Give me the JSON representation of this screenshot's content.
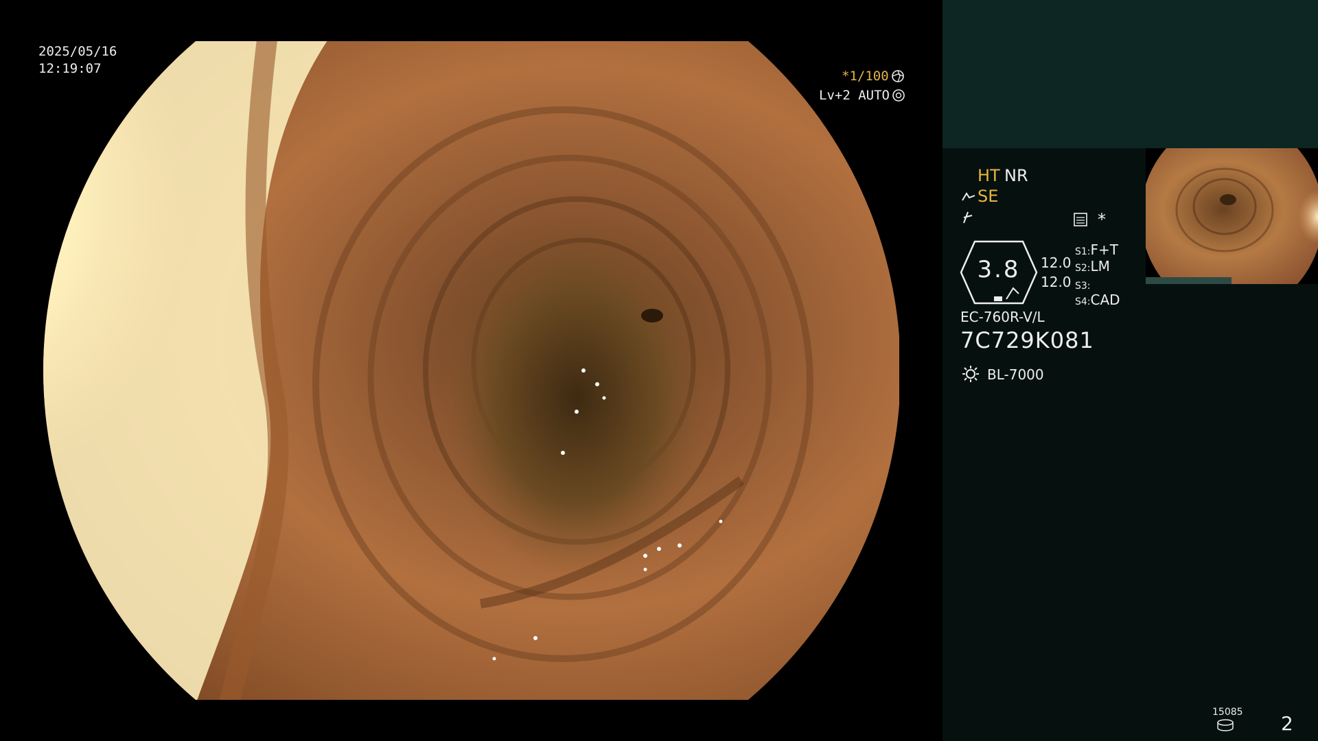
{
  "osd": {
    "date": "2025/05/16",
    "time": "12:19:07",
    "shutter": "*1/100",
    "level": "Lv+2 AUTO"
  },
  "panel": {
    "ht": "HT",
    "nr": "NR",
    "se": "SE",
    "zoom_value": "3.8",
    "val1": "12.0",
    "val2": "12.0",
    "s1_label": "S1:",
    "s1_value": "F+T",
    "s2_label": "S2:",
    "s2_value": "LM",
    "s3_label": "S3:",
    "s3_value": "",
    "s4_label": "S4:",
    "s4_value": "CAD",
    "scope_model": "EC-760R-V/L",
    "serial": "7C729K081",
    "light_source": "BL-7000",
    "counter": "15085",
    "page_number": "2",
    "star": "*"
  },
  "icons": [
    "shutter-mode-icon",
    "auto-iris-icon",
    "scope-angle-icon",
    "structure-enhance-icon",
    "record-icon",
    "light-source-icon",
    "media-counter-icon"
  ],
  "colors": {
    "panel_bg": "#06110f",
    "panel_top": "#0d2623",
    "accent_yellow": "#e8b53f"
  }
}
